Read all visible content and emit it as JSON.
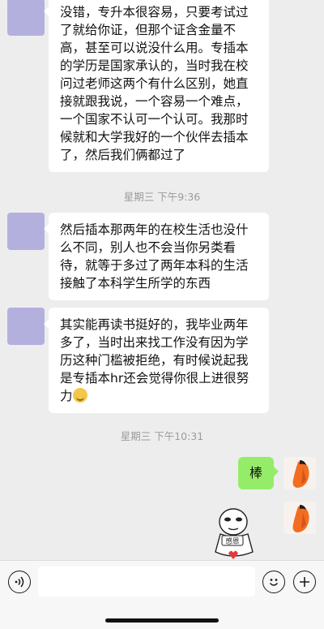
{
  "messages": [
    {
      "side": "left",
      "lines": [
        "没错，专升本很容易，只要考试过",
        "了就给你证，但那个证含金量不",
        "高，甚至可以说没什么用。专插本",
        "的学历是国家承认的，当时我在校",
        "问过老师这两个有什么区别，她直",
        "接就跟我说，一个容易一个难点，",
        "一个国家不认可一个认可。我那时",
        "候就和大学我好的一个伙伴去插本",
        "了，然后我们俩都过了"
      ]
    },
    {
      "side": "left",
      "lines": [
        "然后插本那两年的在校生活也没什",
        "么不同，别人也不会当你另类看",
        "待，就等于多过了两年本科的生活",
        "接触了本科学生所学的东西"
      ]
    },
    {
      "side": "left",
      "lines": [
        "其实能再读书挺好的，我毕业两年",
        "多了，当时出来找工作没有因为学",
        "历这种门槛被拒绝，有时候说起我",
        "是专插本hr还会觉得你很上进很努",
        "力"
      ],
      "trailing_emoji": "grinning-sweat-emoji"
    },
    {
      "side": "right",
      "text": "棒"
    },
    {
      "side": "right",
      "sticker": "panda-thank-you-sticker",
      "sticker_text": "感恩"
    }
  ],
  "timestamps": [
    "星期三 下午9:36",
    "星期三 下午10:31"
  ],
  "input_bar": {
    "voice_icon": "voice-icon",
    "emoji_icon": "emoji-icon",
    "add_icon": "plus-icon",
    "input_value": ""
  },
  "colors": {
    "background": "#ededed",
    "left_bubble": "#ffffff",
    "right_bubble": "#95ec69",
    "left_avatar": "#b4b0de",
    "timestamp_text": "#9c9c9c"
  }
}
